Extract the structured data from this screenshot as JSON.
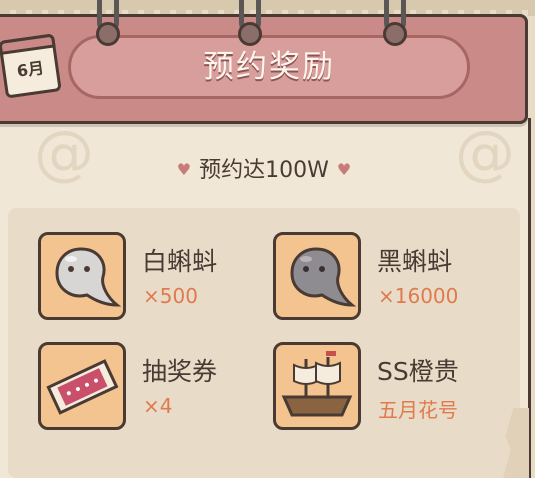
{
  "header": {
    "title": "预约奖励",
    "calendar_label": "6月"
  },
  "milestone": {
    "text": "预约达100W"
  },
  "rewards": [
    {
      "name": "白蝌蚪",
      "qty": "×500",
      "icon": "white-tadpole-icon"
    },
    {
      "name": "黑蝌蚪",
      "qty": "×16000",
      "icon": "black-tadpole-icon"
    },
    {
      "name": "抽奖券",
      "qty": "×4",
      "icon": "lottery-ticket-icon"
    },
    {
      "name": "SS橙贵",
      "qty": "五月花号",
      "icon": "mayflower-ship-icon"
    }
  ],
  "colors": {
    "header_band": "#c98a88",
    "title_pill": "#d89e9b",
    "icon_frame": "#f3c48f",
    "qty_text": "#e07a4e",
    "outline": "#4a3a34"
  }
}
